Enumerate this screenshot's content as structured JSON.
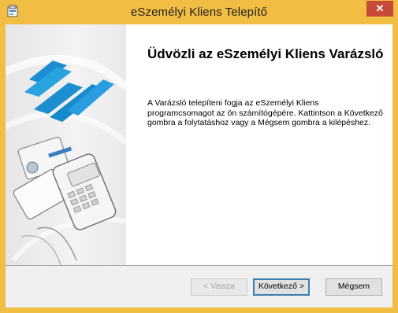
{
  "window": {
    "title": "eSzemélyi Kliens Telepítő",
    "close_label": "✕",
    "accent_color": "#f1bd43"
  },
  "wizard": {
    "heading": "Üdvözli az eSzemélyi Kliens Varázsló",
    "body": "A Varázsló telepíteni fogja az eSzemélyi Kliens programcsomagot az ön számítógépére.  Kattintson a Következő gombra a folytatáshoz vagy a Mégsem gombra a kilépéshez.",
    "logo_icon": "eszemelyi-logo",
    "illustration_icon": "id-card-and-reader-illustration"
  },
  "buttons": {
    "back": "< Vissza",
    "next": "Következő >",
    "cancel": "Mégsem",
    "back_enabled": false
  }
}
